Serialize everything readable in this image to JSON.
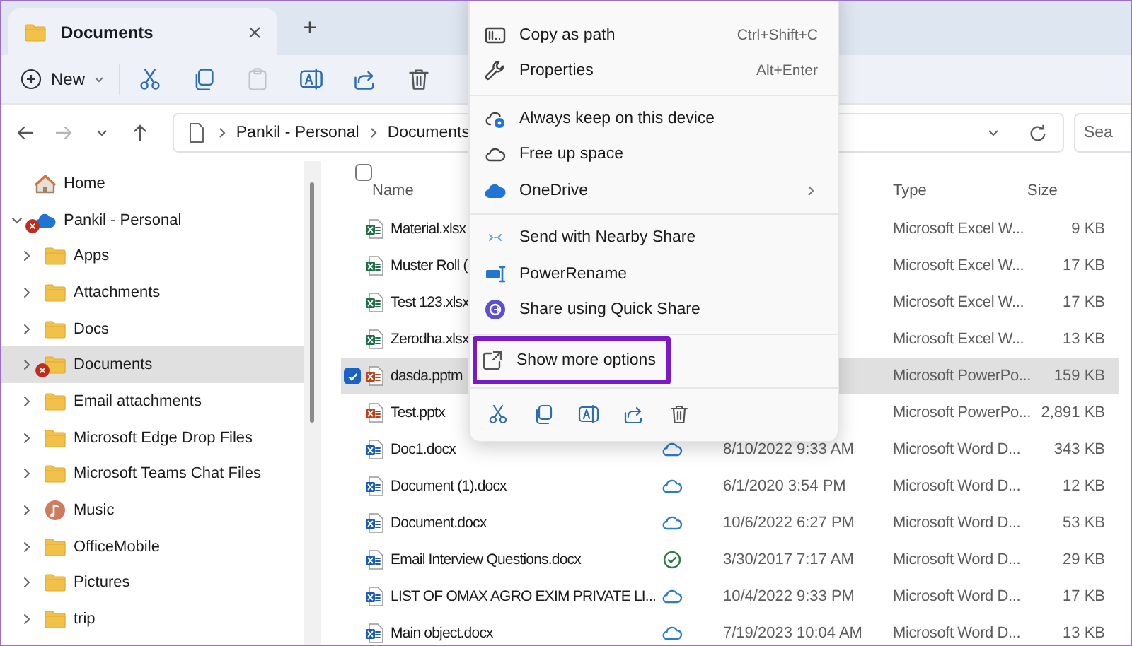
{
  "tab": {
    "title": "Documents",
    "selected": true
  },
  "new_tab": {
    "label": "+"
  },
  "toolbar": {
    "new_button": {
      "label": "New"
    },
    "actions": [
      {
        "kind": "cut",
        "disabled": false
      },
      {
        "kind": "copy",
        "disabled": false
      },
      {
        "kind": "paste",
        "disabled": true
      },
      {
        "kind": "rename",
        "disabled": false
      },
      {
        "kind": "share",
        "disabled": false
      },
      {
        "kind": "delete",
        "disabled": false
      }
    ]
  },
  "nav": {
    "back": {
      "disabled": false
    },
    "forward": {
      "disabled": true
    }
  },
  "address": {
    "crumbs": [
      "Pankil - Personal",
      "Documents"
    ]
  },
  "search": {
    "placeholder": "Sea"
  },
  "sidebar": {
    "items": [
      {
        "kind": "home",
        "label": "Home",
        "selected": false,
        "error": false
      },
      {
        "kind": "cloud",
        "label": "Pankil - Personal",
        "selected": false,
        "error": true,
        "expanded": true,
        "children": [
          {
            "kind": "folder",
            "label": "Apps",
            "selected": false,
            "error": false,
            "expanded": false
          },
          {
            "kind": "folder",
            "label": "Attachments",
            "selected": false,
            "error": false,
            "expanded": false
          },
          {
            "kind": "folder",
            "label": "Docs",
            "selected": false,
            "error": false,
            "expanded": false
          },
          {
            "kind": "folder",
            "label": "Documents",
            "selected": true,
            "error": true,
            "expanded": false
          },
          {
            "kind": "folder",
            "label": "Email attachments",
            "selected": false,
            "error": false,
            "expanded": false
          },
          {
            "kind": "folder",
            "label": "Microsoft Edge Drop Files",
            "selected": false,
            "error": false,
            "expanded": false
          },
          {
            "kind": "folder",
            "label": "Microsoft Teams Chat Files",
            "selected": false,
            "error": false,
            "expanded": false
          },
          {
            "kind": "music",
            "label": "Music",
            "selected": false,
            "error": false,
            "expanded": false
          },
          {
            "kind": "folder",
            "label": "OfficeMobile",
            "selected": false,
            "error": false,
            "expanded": false
          },
          {
            "kind": "folder",
            "label": "Pictures",
            "selected": false,
            "error": false,
            "expanded": false
          },
          {
            "kind": "folder",
            "label": "trip",
            "selected": false,
            "error": false,
            "expanded": false
          }
        ]
      }
    ]
  },
  "files": {
    "select_all": {
      "checked": false
    },
    "columns": [
      {
        "kind": "name",
        "label": "Name"
      },
      {
        "kind": "type",
        "label": "Type"
      },
      {
        "kind": "size",
        "label": "Size"
      }
    ],
    "rows": [
      {
        "kind": "excel",
        "name": "Material.xlsx",
        "type": "Microsoft Excel W...",
        "size": "9 KB",
        "selected": false
      },
      {
        "kind": "excel",
        "name": "Muster Roll (",
        "type": "Microsoft Excel W...",
        "size": "17 KB",
        "selected": false
      },
      {
        "kind": "excel",
        "name": "Test 123.xlsx",
        "type": "Microsoft Excel W...",
        "size": "17 KB",
        "selected": false
      },
      {
        "kind": "excel",
        "name": "Zerodha.xlsx",
        "type": "Microsoft Excel W...",
        "size": "13 KB",
        "selected": false
      },
      {
        "kind": "powerpoint",
        "name": "dasda.pptm",
        "type": "Microsoft PowerPo...",
        "size": "159 KB",
        "selected": true
      },
      {
        "kind": "powerpoint",
        "name": "Test.pptx",
        "type": "Microsoft PowerPo...",
        "size": "2,891 KB",
        "selected": false
      },
      {
        "kind": "word",
        "name": "Doc1.docx",
        "synced": false,
        "date": "8/10/2022 9:33 AM",
        "type": "Microsoft Word D...",
        "size": "343 KB",
        "selected": false
      },
      {
        "kind": "word",
        "name": "Document (1).docx",
        "synced": false,
        "date": "6/1/2020 3:54 PM",
        "type": "Microsoft Word D...",
        "size": "12 KB",
        "selected": false
      },
      {
        "kind": "word",
        "name": "Document.docx",
        "synced": false,
        "date": "10/6/2022 6:27 PM",
        "type": "Microsoft Word D...",
        "size": "53 KB",
        "selected": false
      },
      {
        "kind": "word",
        "name": "Email Interview Questions.docx",
        "synced": true,
        "date": "3/30/2017 7:17 AM",
        "type": "Microsoft Word D...",
        "size": "29 KB",
        "selected": false
      },
      {
        "kind": "word",
        "name": "LIST OF OMAX AGRO EXIM PRIVATE LI...",
        "synced": false,
        "date": "10/4/2022 9:33 PM",
        "type": "Microsoft Word D...",
        "size": "17 KB",
        "selected": false
      },
      {
        "kind": "word",
        "name": "Main object.docx",
        "synced": false,
        "date": "7/19/2023 10:04 AM",
        "type": "Microsoft Word D...",
        "size": "13 KB",
        "selected": false
      }
    ]
  },
  "context_menu": {
    "items": [
      {
        "kind": "item",
        "label": "Copy as path",
        "shortcut": "Ctrl+Shift+C",
        "highlighted": false
      },
      {
        "kind": "item",
        "label": "Properties",
        "shortcut": "Alt+Enter",
        "highlighted": false
      },
      {
        "kind": "separator"
      },
      {
        "kind": "item",
        "label": "Always keep on this device",
        "highlighted": false
      },
      {
        "kind": "item",
        "label": "Free up space",
        "highlighted": false
      },
      {
        "kind": "submenu",
        "label": "OneDrive",
        "highlighted": false
      },
      {
        "kind": "separator"
      },
      {
        "kind": "item",
        "label": "Send with Nearby Share",
        "highlighted": false
      },
      {
        "kind": "item",
        "label": "PowerRename",
        "highlighted": false
      },
      {
        "kind": "item",
        "label": "Share using Quick Share",
        "highlighted": false
      },
      {
        "kind": "separator"
      },
      {
        "kind": "item",
        "label": "Show more options",
        "highlighted": true
      },
      {
        "kind": "separator"
      }
    ],
    "actions": [
      {
        "kind": "cut"
      },
      {
        "kind": "copy"
      },
      {
        "kind": "rename"
      },
      {
        "kind": "share"
      },
      {
        "kind": "delete"
      }
    ]
  }
}
